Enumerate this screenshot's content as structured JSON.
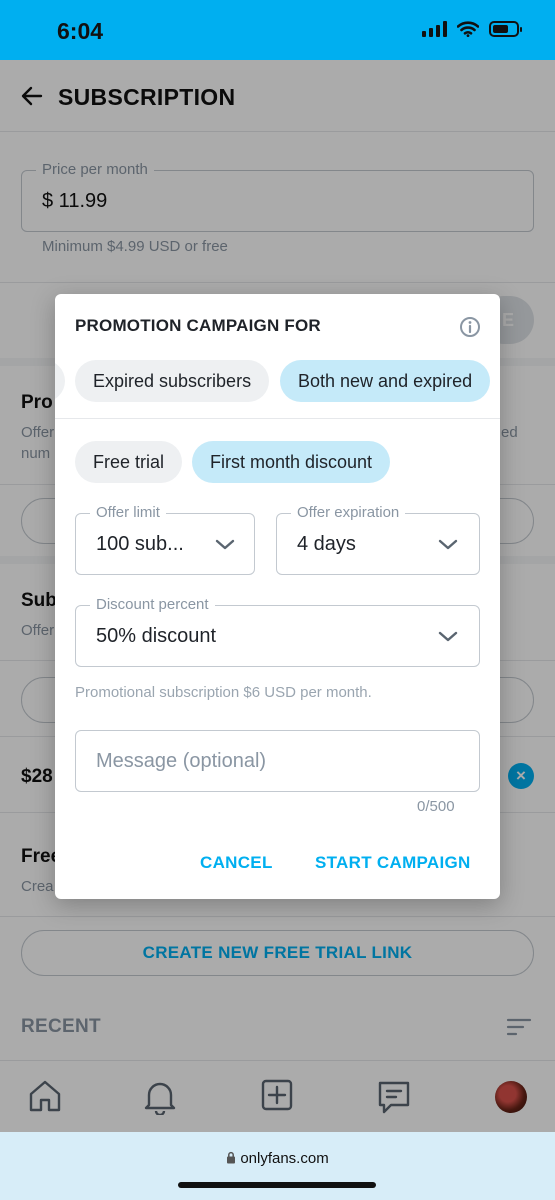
{
  "status_bar": {
    "time": "6:04"
  },
  "header": {
    "title": "SUBSCRIPTION"
  },
  "price": {
    "label": "Price per month",
    "value": "$ 11.99",
    "hint": "Minimum $4.99 USD or free"
  },
  "background": {
    "save_label": "E",
    "section1_heading": "Pro",
    "section1_sub_1": "Offer",
    "section1_sub_2": "num",
    "section1_sub_right": "ed",
    "section2_heading": "Sub",
    "section2_sub": "Offer",
    "price_row": "$28",
    "section3_heading": "Free",
    "section3_sub": "Crea",
    "create_link_label": "CREATE NEW FREE TRIAL LINK",
    "recent_label": "RECENT"
  },
  "dialog": {
    "title": "PROMOTION CAMPAIGN FOR",
    "audience_chips": [
      {
        "label": "Expired subscribers",
        "selected": false
      },
      {
        "label": "Both new and expired",
        "selected": true
      }
    ],
    "type_chips": [
      {
        "label": "Free trial",
        "selected": false
      },
      {
        "label": "First month discount",
        "selected": true
      }
    ],
    "offer_limit": {
      "label": "Offer limit",
      "value": "100 sub..."
    },
    "offer_expiration": {
      "label": "Offer expiration",
      "value": "4 days"
    },
    "discount_percent": {
      "label": "Discount percent",
      "value": "50% discount"
    },
    "promo_note": "Promotional subscription $6 USD per month.",
    "message": {
      "placeholder": "Message (optional)",
      "counter": "0/500"
    },
    "cancel_label": "CANCEL",
    "start_label": "START CAMPAIGN"
  },
  "browser": {
    "url": "onlyfans.com"
  },
  "colors": {
    "accent": "#00aff0",
    "selected_chip": "#c5eaf9",
    "chip": "#eef0f2",
    "status_bar": "#00aff0",
    "browser_bar": "#d7edf8"
  }
}
